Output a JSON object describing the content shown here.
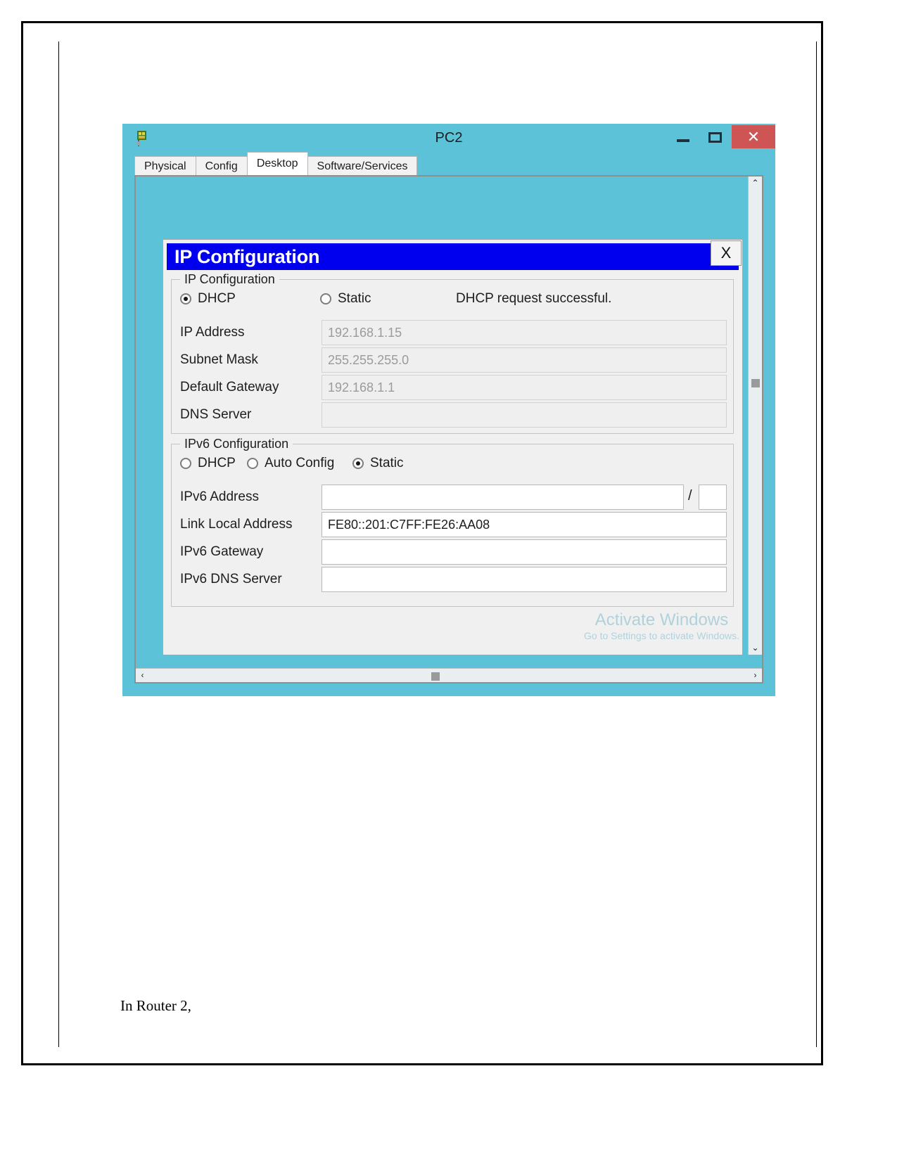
{
  "window": {
    "title": "PC2",
    "icon": "packet-tracer-icon",
    "controls": {
      "minimize": "–",
      "maximize": "▢",
      "close": "✕"
    },
    "tabs": [
      {
        "label": "Physical",
        "active": false
      },
      {
        "label": "Config",
        "active": false
      },
      {
        "label": "Desktop",
        "active": true
      },
      {
        "label": "Software/Services",
        "active": false
      }
    ],
    "scrollbars": {
      "up_arrow": "⌃",
      "down_arrow": "⌄",
      "left_arrow": "‹",
      "right_arrow": "›"
    },
    "watermark": {
      "line1": "Activate Windows",
      "line2": "Go to Settings to activate Windows."
    },
    "desktop_icon": "traffic-generator-icon"
  },
  "dialog": {
    "title": "IP Configuration",
    "close_label": "X",
    "ipv4": {
      "legend": "IP Configuration",
      "modes": [
        {
          "label": "DHCP",
          "selected": true
        },
        {
          "label": "Static",
          "selected": false
        }
      ],
      "status": "DHCP request successful.",
      "fields": [
        {
          "label": "IP Address",
          "value": "192.168.1.15",
          "enabled": false
        },
        {
          "label": "Subnet Mask",
          "value": "255.255.255.0",
          "enabled": false
        },
        {
          "label": "Default Gateway",
          "value": "192.168.1.1",
          "enabled": false
        },
        {
          "label": "DNS Server",
          "value": "",
          "enabled": false
        }
      ]
    },
    "ipv6": {
      "legend": "IPv6 Configuration",
      "modes": [
        {
          "label": "DHCP",
          "selected": false
        },
        {
          "label": "Auto Config",
          "selected": false
        },
        {
          "label": "Static",
          "selected": true
        }
      ],
      "prefix_separator": "/",
      "prefix_value": "",
      "fields": [
        {
          "label": "IPv6 Address",
          "value": "",
          "enabled": true
        },
        {
          "label": "Link Local Address",
          "value": "FE80::201:C7FF:FE26:AA08",
          "enabled": true
        },
        {
          "label": "IPv6 Gateway",
          "value": "",
          "enabled": true
        },
        {
          "label": "IPv6 DNS Server",
          "value": "",
          "enabled": true
        }
      ]
    }
  },
  "document": {
    "caption": "In Router 2,"
  },
  "colors": {
    "window_chrome": "#5bc2d8",
    "close_button": "#cf5454",
    "dialog_title_bar": "#0000ee",
    "dialog_background": "#f0f0f0",
    "disabled_text": "#9b9b9b"
  }
}
